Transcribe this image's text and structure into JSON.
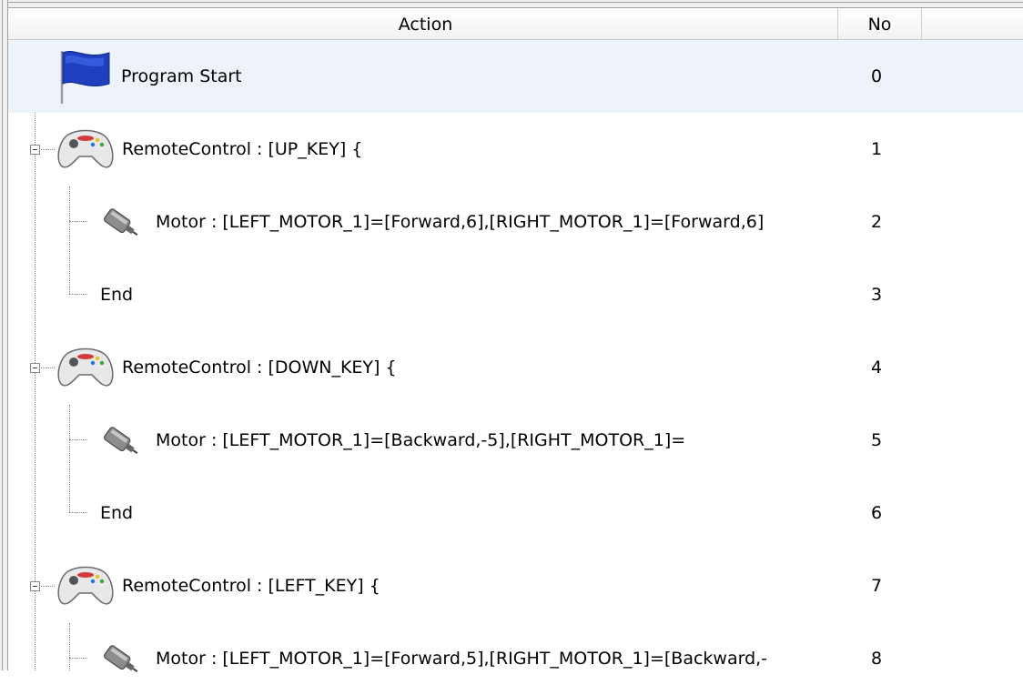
{
  "columns": {
    "action": "Action",
    "no": "No"
  },
  "rows": [
    {
      "label": "Program Start",
      "no": "0",
      "icon": "flag-icon"
    },
    {
      "label": "RemoteControl : [UP_KEY] {",
      "no": "1",
      "icon": "gamepad-icon"
    },
    {
      "label": "Motor : [LEFT_MOTOR_1]=[Forward,6],[RIGHT_MOTOR_1]=[Forward,6]",
      "no": "2",
      "icon": "motor-icon"
    },
    {
      "label": "End",
      "no": "3"
    },
    {
      "label": "RemoteControl : [DOWN_KEY] {",
      "no": "4",
      "icon": "gamepad-icon"
    },
    {
      "label": "Motor : [LEFT_MOTOR_1]=[Backward,-5],[RIGHT_MOTOR_1]=",
      "no": "5",
      "icon": "motor-icon"
    },
    {
      "label": "End",
      "no": "6"
    },
    {
      "label": "RemoteControl : [LEFT_KEY] {",
      "no": "7",
      "icon": "gamepad-icon"
    },
    {
      "label": "Motor : [LEFT_MOTOR_1]=[Forward,5],[RIGHT_MOTOR_1]=[Backward,-",
      "no": "8",
      "icon": "motor-icon"
    }
  ]
}
